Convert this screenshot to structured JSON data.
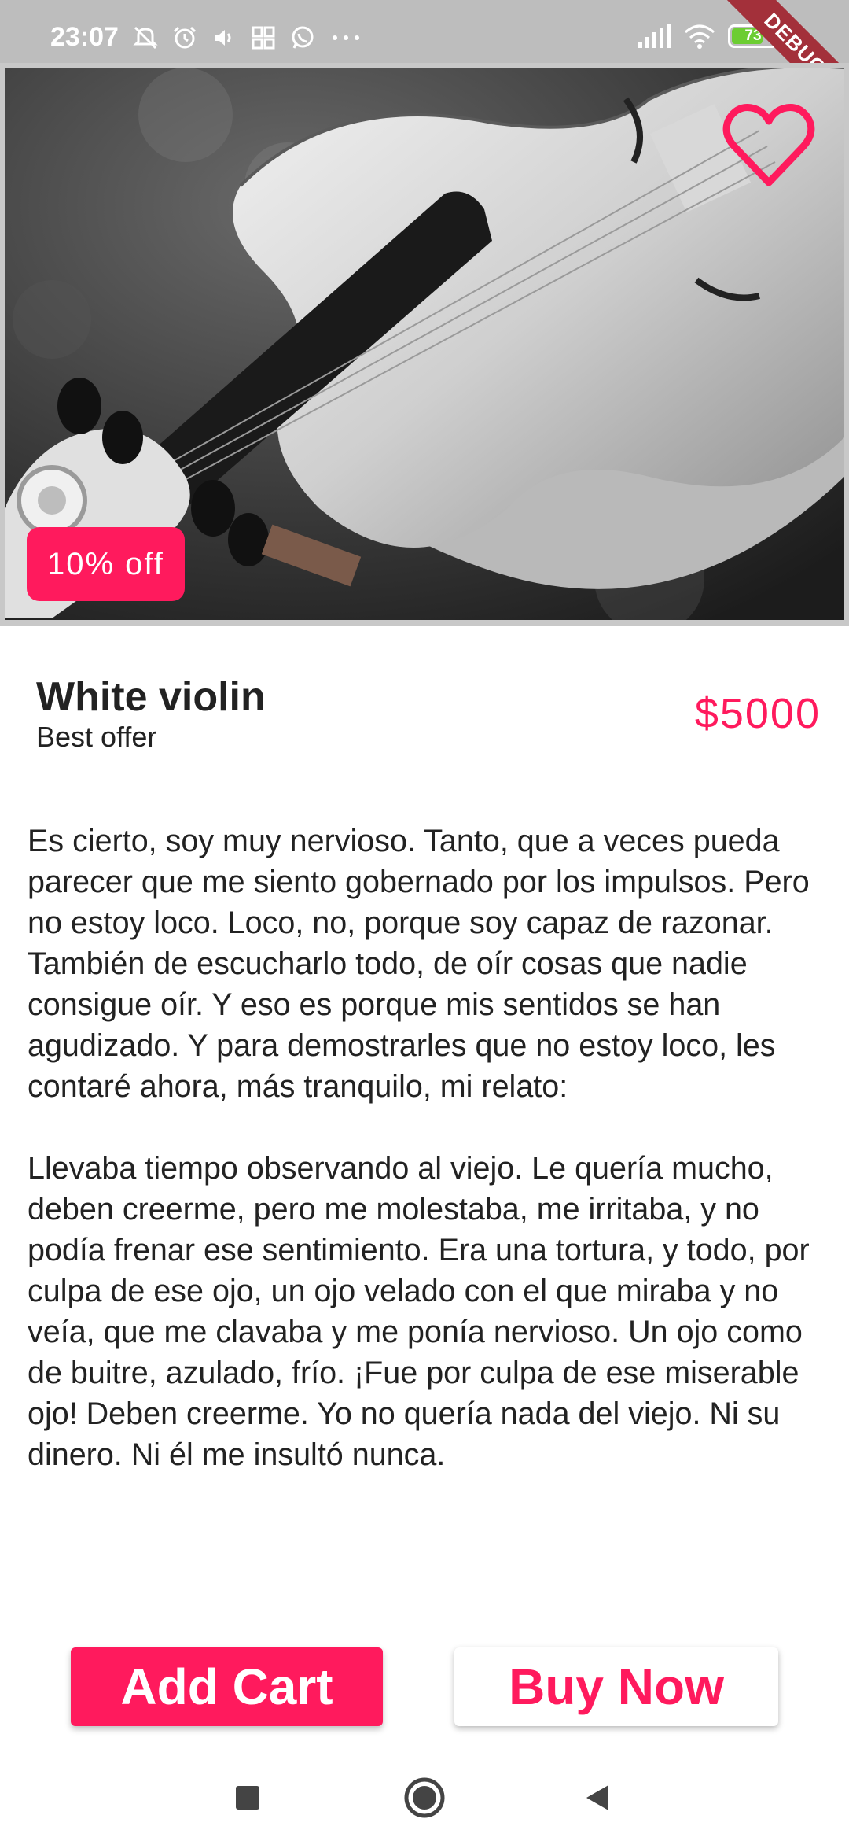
{
  "status_bar": {
    "time": "23:07",
    "battery_level": "73",
    "battery_color": "#6ccd32",
    "debug_label": "DEBUG",
    "left_icons": [
      "mute-icon",
      "alarm-icon",
      "volume-icon",
      "app-grid-icon",
      "whatsapp-icon",
      "more-dots-icon"
    ],
    "right_icons": [
      "signal-icon",
      "wifi-icon",
      "battery-icon"
    ]
  },
  "hero": {
    "image": "white-violin-photo",
    "favorite_icon": "heart-outline-icon",
    "discount_label": "10% off"
  },
  "product": {
    "title": "White violin",
    "subtitle": "Best offer",
    "price": "$5000"
  },
  "description": {
    "paragraph_1": "Es cierto, soy muy nervioso. Tanto, que a veces pueda parecer que me siento gobernado por los impulsos. Pero no estoy loco. Loco, no, porque soy capaz de razonar. También de escucharlo todo, de oír cosas que nadie consigue oír. Y eso es porque mis sentidos se han agudizado. Y para demostrarles que no estoy loco, les contaré ahora, más tranquilo, mi relato:",
    "paragraph_2": "Llevaba tiempo observando al viejo. Le quería mucho, deben creerme, pero me molestaba, me irritaba, y no podía frenar ese sentimiento. Era una tortura, y todo, por culpa de ese ojo, un ojo velado con el que miraba y no veía, que me clavaba y me ponía nervioso. Un ojo como de buitre, azulado, frío. ¡Fue por culpa de ese miserable ojo! Deben creerme. Yo no quería nada del viejo. Ni su dinero. Ni él me insultó nunca."
  },
  "actions": {
    "add_cart_label": "Add Cart",
    "buy_now_label": "Buy Now"
  },
  "nav": {
    "icons": [
      "recent-apps-icon",
      "home-icon",
      "back-icon"
    ]
  },
  "colors": {
    "accent": "#ff1a5d",
    "status_bar": "#bdbdbd",
    "text": "#222222"
  }
}
